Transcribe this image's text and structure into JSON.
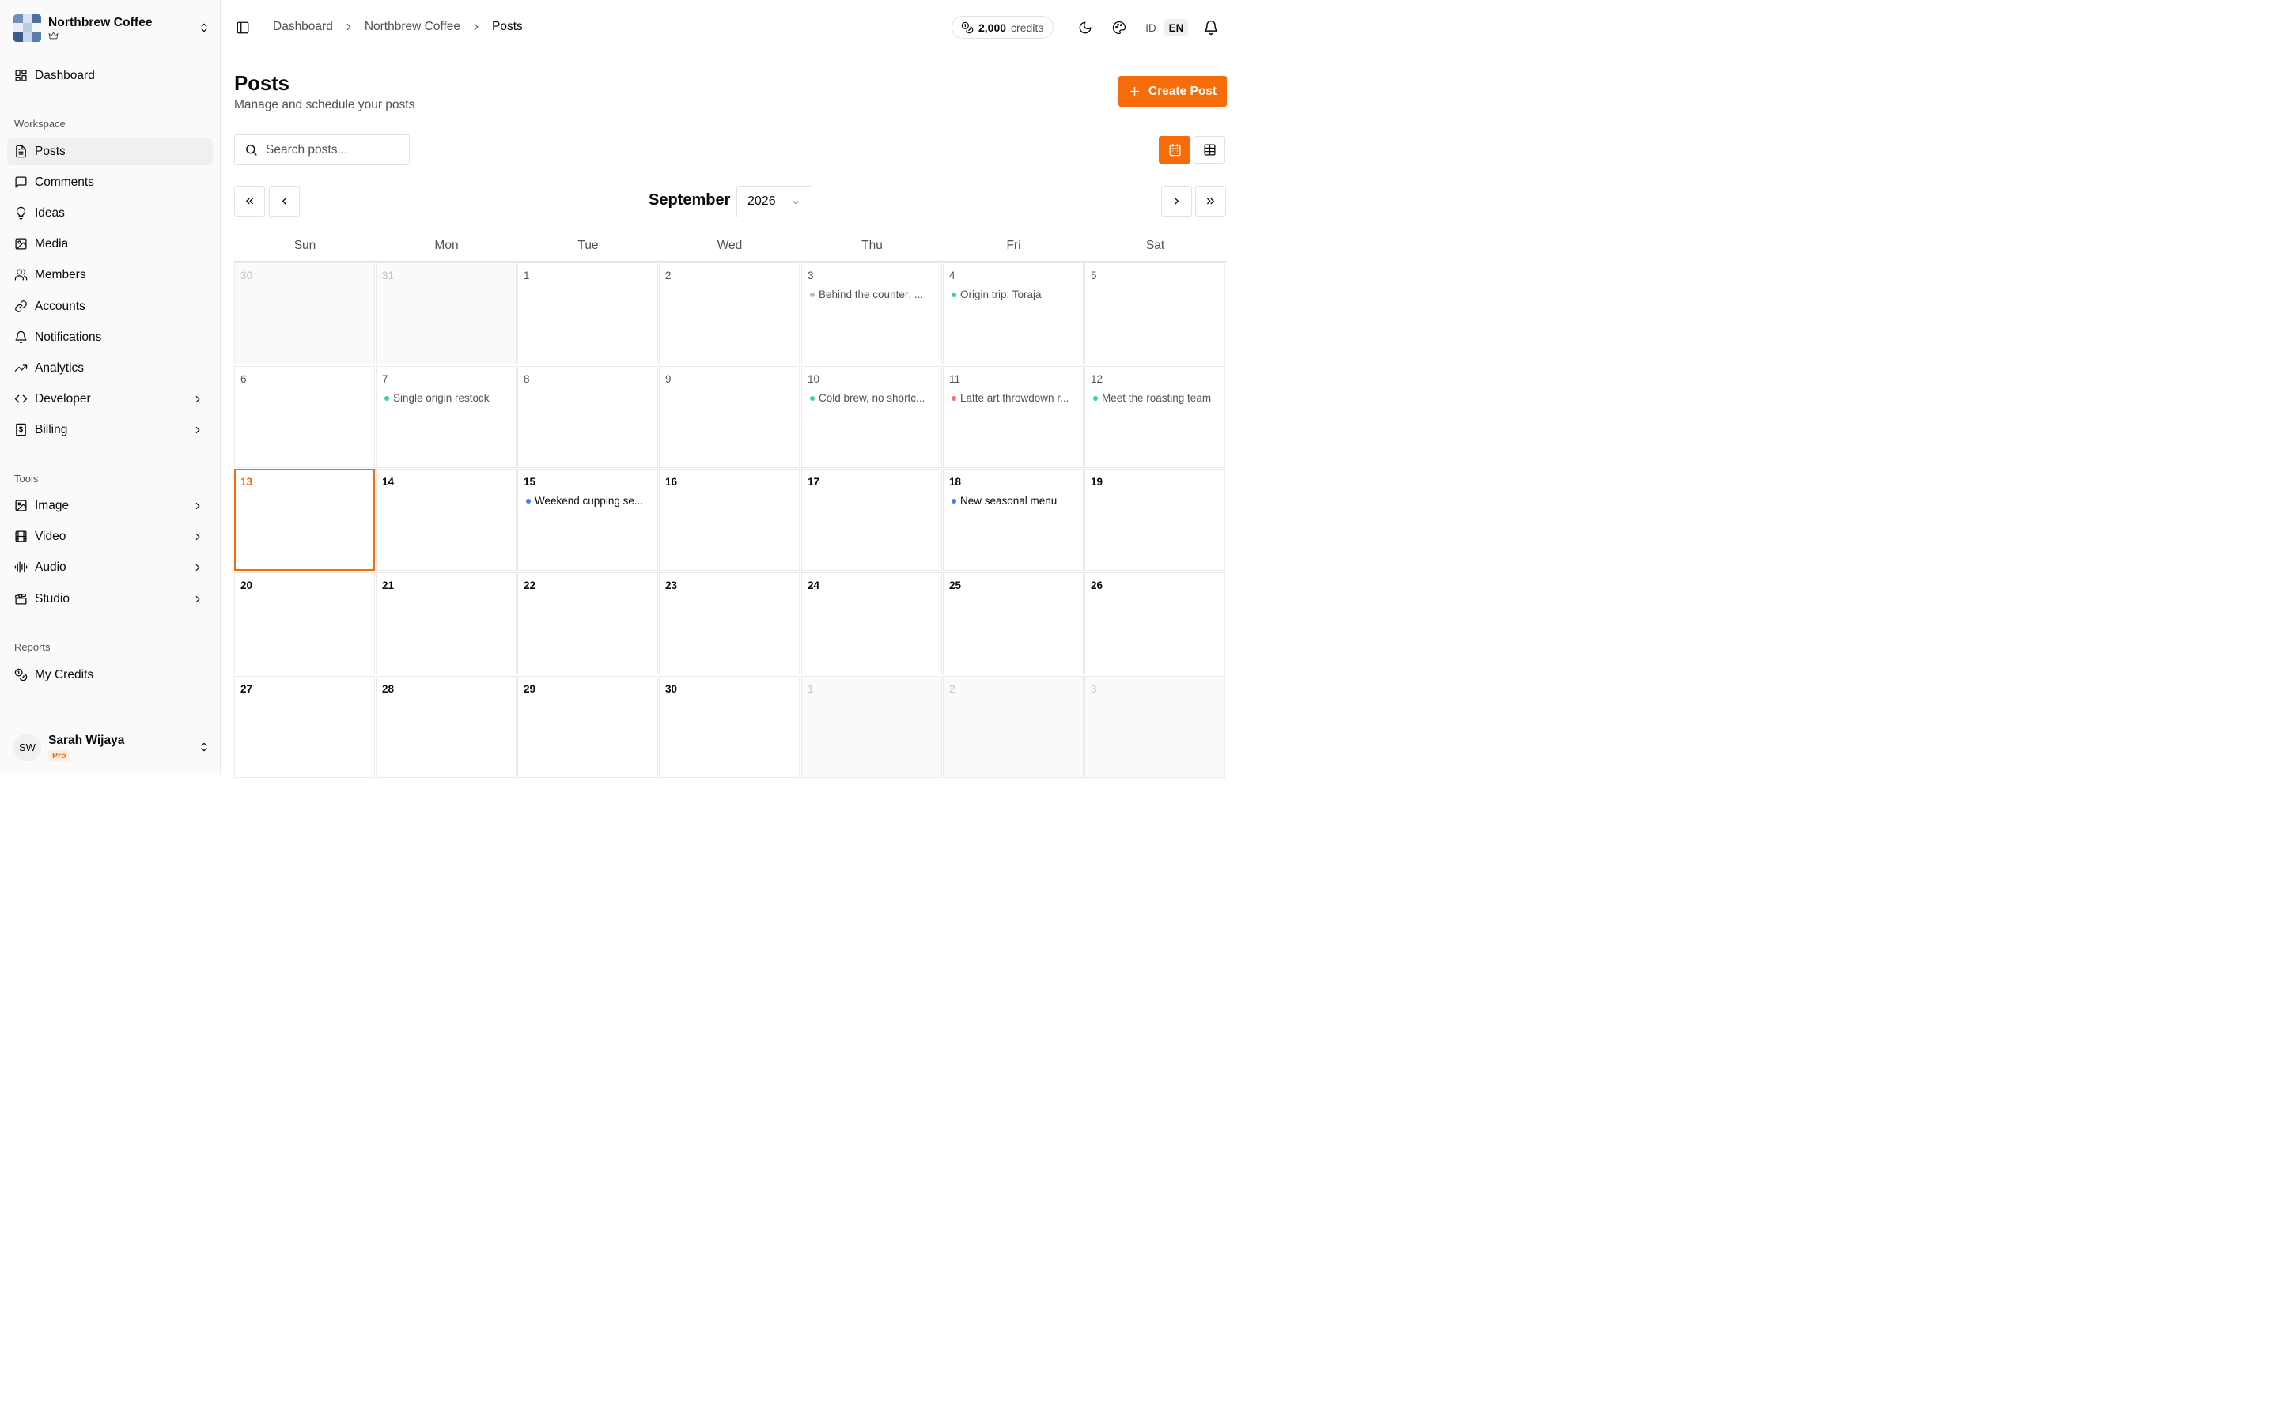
{
  "org": {
    "name": "Northbrew Coffee"
  },
  "sidebar": {
    "top_item": "Dashboard",
    "sections": {
      "workspace": "Workspace",
      "tools": "Tools",
      "reports": "Reports"
    },
    "workspace_items": [
      {
        "label": "Posts",
        "icon": "file-text-icon",
        "active": true
      },
      {
        "label": "Comments",
        "icon": "message-square-icon"
      },
      {
        "label": "Ideas",
        "icon": "lightbulb-icon"
      },
      {
        "label": "Media",
        "icon": "image-icon"
      },
      {
        "label": "Members",
        "icon": "users-icon"
      },
      {
        "label": "Accounts",
        "icon": "link-icon"
      },
      {
        "label": "Notifications",
        "icon": "bell-icon"
      },
      {
        "label": "Analytics",
        "icon": "trending-up-icon"
      },
      {
        "label": "Developer",
        "icon": "code-icon",
        "expandable": true
      },
      {
        "label": "Billing",
        "icon": "receipt-icon",
        "expandable": true
      }
    ],
    "tools_items": [
      {
        "label": "Image",
        "icon": "image-icon",
        "expandable": true
      },
      {
        "label": "Video",
        "icon": "film-icon",
        "expandable": true
      },
      {
        "label": "Audio",
        "icon": "audio-waveform-icon",
        "expandable": true
      },
      {
        "label": "Studio",
        "icon": "clapperboard-icon",
        "expandable": true
      }
    ],
    "reports_items": [
      {
        "label": "My Credits",
        "icon": "coins-icon"
      }
    ]
  },
  "user": {
    "initials": "SW",
    "name": "Sarah Wijaya",
    "plan": "Pro"
  },
  "header": {
    "breadcrumb": [
      "Dashboard",
      "Northbrew Coffee",
      "Posts"
    ],
    "credits_value": "2,000",
    "credits_unit": "credits",
    "lang_id": "ID",
    "lang_en": "EN"
  },
  "page": {
    "title": "Posts",
    "subtitle": "Manage and schedule your posts",
    "create_label": "Create Post",
    "search_placeholder": "Search posts..."
  },
  "calendar": {
    "month": "September",
    "year": "2026",
    "weekdays": [
      "Sun",
      "Mon",
      "Tue",
      "Wed",
      "Thu",
      "Fri",
      "Sat"
    ],
    "event_colors": {
      "gray": "#bdbdbd",
      "green": "#34d399",
      "red": "#f87171",
      "blue": "#3b82f6"
    },
    "days": [
      {
        "n": "30",
        "muted": true
      },
      {
        "n": "31",
        "muted": true
      },
      {
        "n": "1"
      },
      {
        "n": "2"
      },
      {
        "n": "3",
        "event": "Behind the counter: ...",
        "color": "gray"
      },
      {
        "n": "4",
        "event": "Origin trip: Toraja",
        "color": "green"
      },
      {
        "n": "5"
      },
      {
        "n": "6"
      },
      {
        "n": "7",
        "event": "Single origin restock",
        "color": "green"
      },
      {
        "n": "8"
      },
      {
        "n": "9"
      },
      {
        "n": "10",
        "event": "Cold brew, no shortc...",
        "color": "green"
      },
      {
        "n": "11",
        "event": "Latte art throwdown r...",
        "color": "red"
      },
      {
        "n": "12",
        "event": "Meet the roasting team",
        "color": "green"
      },
      {
        "n": "13",
        "today": true,
        "bold": true
      },
      {
        "n": "14",
        "bold": true
      },
      {
        "n": "15",
        "bold": true,
        "event": "Weekend cupping se...",
        "color": "blue"
      },
      {
        "n": "16",
        "bold": true
      },
      {
        "n": "17",
        "bold": true
      },
      {
        "n": "18",
        "bold": true,
        "event": "New seasonal menu",
        "color": "blue"
      },
      {
        "n": "19",
        "bold": true
      },
      {
        "n": "20",
        "bold": true
      },
      {
        "n": "21",
        "bold": true
      },
      {
        "n": "22",
        "bold": true
      },
      {
        "n": "23",
        "bold": true
      },
      {
        "n": "24",
        "bold": true
      },
      {
        "n": "25",
        "bold": true
      },
      {
        "n": "26",
        "bold": true
      },
      {
        "n": "27",
        "bold": true
      },
      {
        "n": "28",
        "bold": true
      },
      {
        "n": "29",
        "bold": true
      },
      {
        "n": "30",
        "bold": true
      },
      {
        "n": "1",
        "muted": true
      },
      {
        "n": "2",
        "muted": true
      },
      {
        "n": "3",
        "muted": true
      }
    ]
  },
  "colors": {
    "accent": "#f76c0a"
  }
}
